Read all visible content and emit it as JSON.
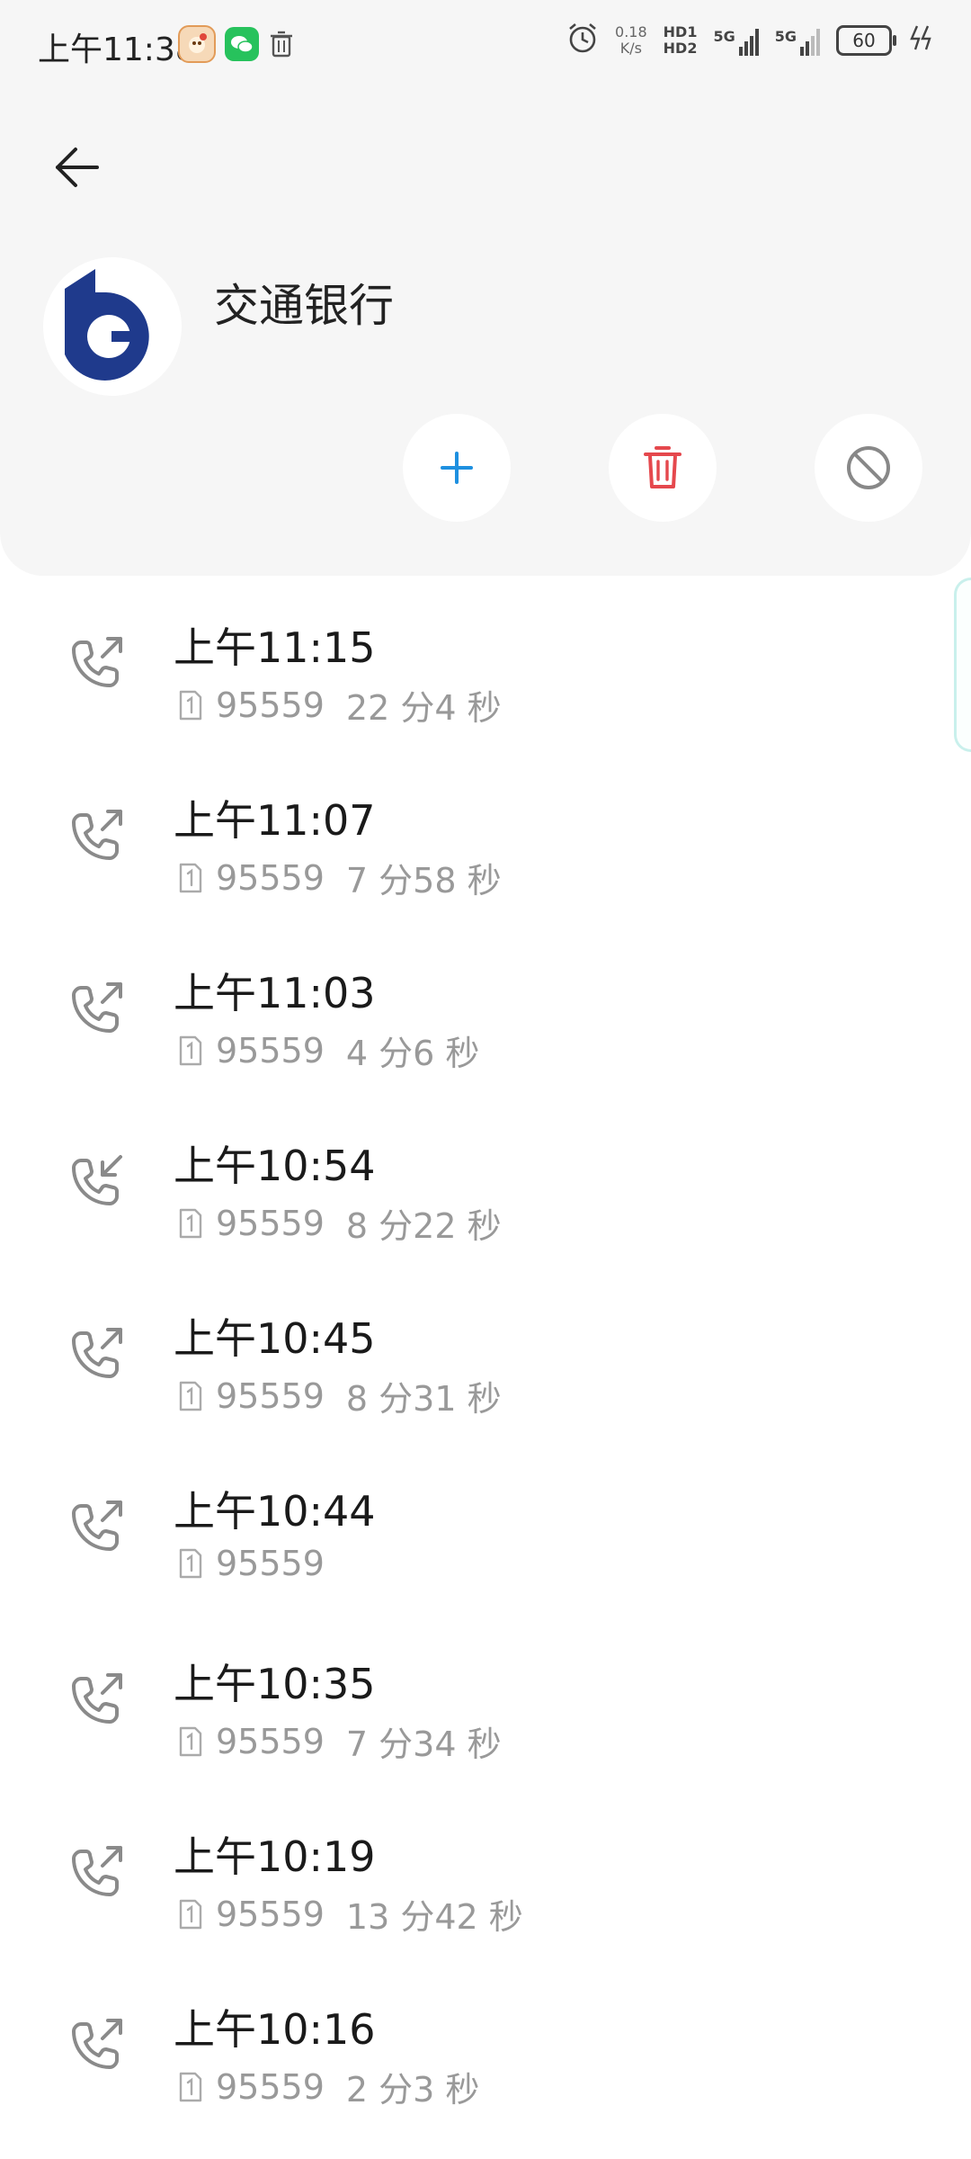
{
  "status_bar": {
    "time": "上午11:38",
    "speed_value": "0.18",
    "speed_unit": "K/s",
    "hd1": "HD1",
    "hd2": "HD2",
    "net1": "5G",
    "net2": "5G",
    "battery": "60"
  },
  "contact": {
    "name": "交通银行"
  },
  "colors": {
    "add": "#1e90e0",
    "delete": "#e5484d",
    "block": "#888888",
    "logo_blue": "#1f3a8c"
  },
  "calls": [
    {
      "direction": "outgoing",
      "time": "上午11:15",
      "number": "95559",
      "duration": "22 分4 秒"
    },
    {
      "direction": "outgoing",
      "time": "上午11:07",
      "number": "95559",
      "duration": "7 分58 秒"
    },
    {
      "direction": "outgoing",
      "time": "上午11:03",
      "number": "95559",
      "duration": "4 分6 秒"
    },
    {
      "direction": "incoming",
      "time": "上午10:54",
      "number": "95559",
      "duration": "8 分22 秒"
    },
    {
      "direction": "outgoing",
      "time": "上午10:45",
      "number": "95559",
      "duration": "8 分31 秒"
    },
    {
      "direction": "outgoing",
      "time": "上午10:44",
      "number": "95559",
      "duration": ""
    },
    {
      "direction": "outgoing",
      "time": "上午10:35",
      "number": "95559",
      "duration": "7 分34 秒"
    },
    {
      "direction": "outgoing",
      "time": "上午10:19",
      "number": "95559",
      "duration": "13 分42 秒"
    },
    {
      "direction": "outgoing",
      "time": "上午10:16",
      "number": "95559",
      "duration": "2 分3 秒"
    }
  ]
}
